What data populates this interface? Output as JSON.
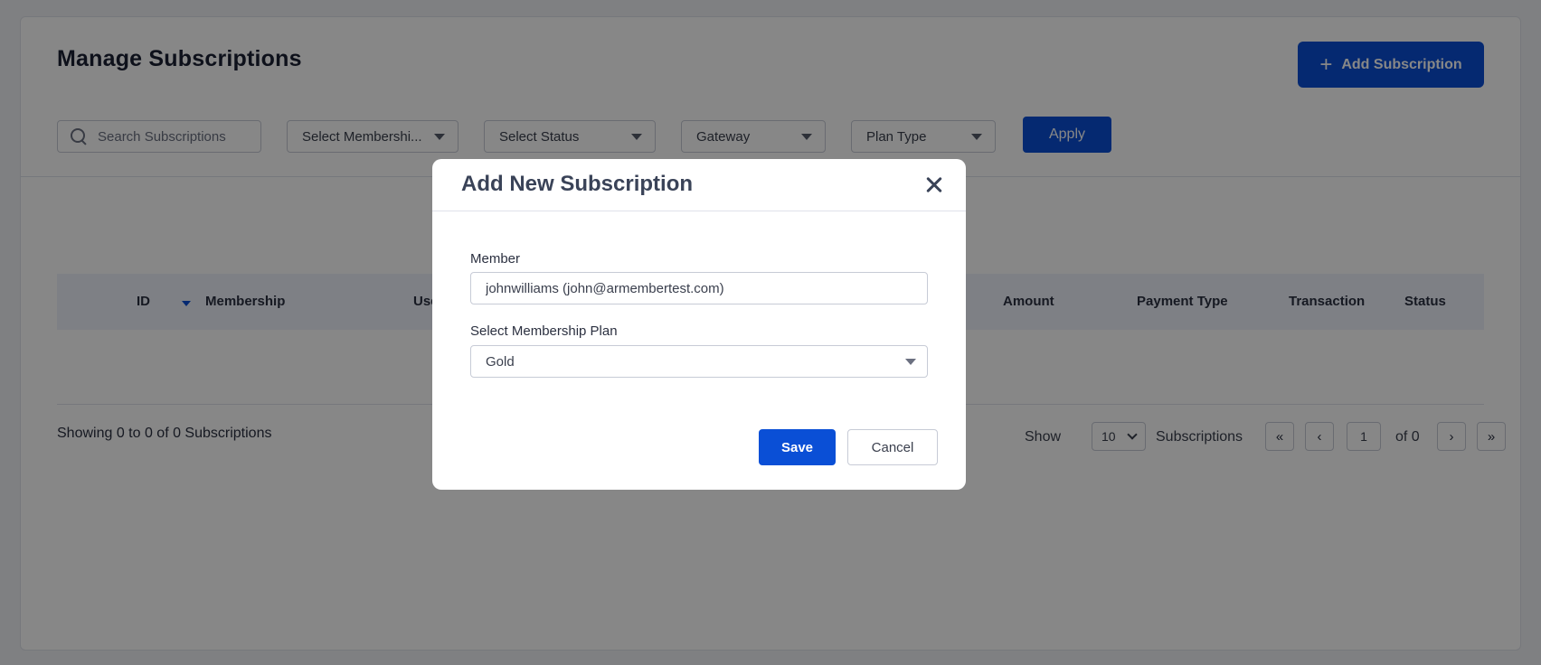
{
  "page": {
    "title": "Manage Subscriptions",
    "add_button_label": "Add Subscription"
  },
  "filters": {
    "search_placeholder": "Search Subscriptions",
    "membership_select": "Select Membershi...",
    "status_select": "Select Status",
    "gateway_select": "Gateway",
    "plan_type_select": "Plan Type",
    "apply_label": "Apply"
  },
  "table": {
    "columns": [
      "ID",
      "Membership",
      "Use",
      "Amount",
      "Payment Type",
      "Transaction",
      "Status"
    ]
  },
  "footer": {
    "showing_text": "Showing 0 to 0 of 0 Subscriptions",
    "show_label": "Show",
    "per_page_value": "10",
    "subscriptions_label": "Subscriptions",
    "first_label": "«",
    "prev_label": "‹",
    "current_page": "1",
    "of_total": "of 0",
    "next_label": "›",
    "last_label": "»"
  },
  "modal": {
    "title": "Add New Subscription",
    "member_label": "Member",
    "member_value": "johnwilliams (john@armembertest.com)",
    "plan_label": "Select Membership Plan",
    "plan_value": "Gold",
    "save_label": "Save",
    "cancel_label": "Cancel"
  },
  "colors": {
    "primary": "#0a4fd6",
    "overlay": "#000000",
    "table_header_bg": "#eef2fb"
  },
  "icons": [
    "plus-icon",
    "search-icon",
    "chevron-down-icon",
    "sort-desc-icon",
    "close-icon"
  ]
}
